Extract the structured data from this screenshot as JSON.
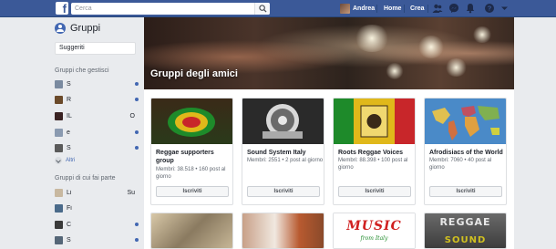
{
  "topbar": {
    "logo": "f",
    "search_placeholder": "Cerca",
    "user_name": "Andrea",
    "home_label": "Home",
    "create_label": "Crea",
    "icons": [
      "friends-icon",
      "messenger-icon",
      "notifications-icon",
      "help-icon",
      "dropdown-icon"
    ]
  },
  "sidebar": {
    "title": "Gruppi",
    "suggested_label": "Suggeriti",
    "managed_heading": "Gruppi che gestisci",
    "managed_items": [
      {
        "label": "S",
        "extra": "",
        "unread": true,
        "color": "#7a8aa0"
      },
      {
        "label": "R",
        "extra": "",
        "unread": true,
        "color": "#6b4a2a"
      },
      {
        "label": "IL",
        "extra": "O",
        "unread": false,
        "color": "#3a2222"
      },
      {
        "label": "e",
        "extra": "",
        "unread": true,
        "color": "#8a9ab0"
      },
      {
        "label": "S",
        "extra": "",
        "unread": true,
        "color": "#5a5a5a"
      }
    ],
    "more_label": "Altri",
    "member_heading": "Gruppi di cui fai parte",
    "member_items": [
      {
        "label": "Li",
        "extra": "Su",
        "unread": false,
        "color": "#c8b8a0"
      },
      {
        "label": "Fi",
        "extra": "",
        "unread": false,
        "color": "#4a6a8a"
      },
      {
        "label": "C",
        "extra": "",
        "unread": true,
        "color": "#3a3a3a"
      },
      {
        "label": "S",
        "extra": "",
        "unread": true,
        "color": "#556677"
      }
    ]
  },
  "banner": {
    "title": "Gruppi degli amici"
  },
  "cards": [
    {
      "name": "Reggae supporters group",
      "meta": "Membri: 38.518 • 160 post al giorno",
      "join_label": "Iscriviti"
    },
    {
      "name": "Sound System Italy",
      "meta": "Membri: 2551 • 2 post al giorno",
      "join_label": "Iscriviti"
    },
    {
      "name": "Roots Reggae Voices",
      "meta": "Membri: 88.398 • 100 post al giorno",
      "join_label": "Iscriviti"
    },
    {
      "name": "Afrodisiacs of the World",
      "meta": "Membri: 7060 • 40 post al giorno",
      "join_label": "Iscriviti"
    }
  ],
  "second_row": [
    {
      "img_text": ""
    },
    {
      "img_text": ""
    },
    {
      "img_text": "MUSIC",
      "img_subtext": "from Italy"
    },
    {
      "img_text": "REGGAE",
      "img_subtext": "SOUND"
    }
  ],
  "colors": {
    "brand": "#3b5998",
    "accent": "#4267b2",
    "background": "#e9ebee"
  }
}
